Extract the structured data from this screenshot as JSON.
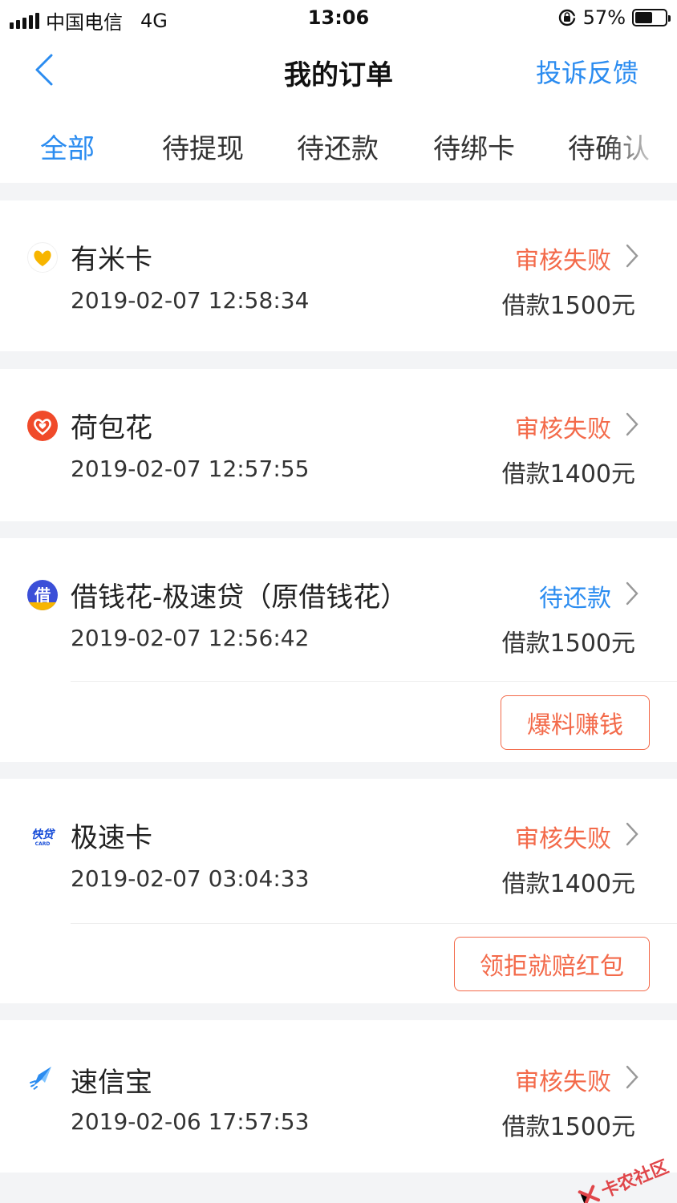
{
  "status_bar": {
    "carrier": "中国电信",
    "network": "4G",
    "time": "13:06",
    "battery_percent": "57%",
    "battery_level": 0.57
  },
  "nav": {
    "title": "我的订单",
    "action_label": "投诉反馈"
  },
  "tabs": [
    {
      "label": "全部",
      "active": true
    },
    {
      "label": "待提现",
      "active": false
    },
    {
      "label": "待还款",
      "active": false
    },
    {
      "label": "待绑卡",
      "active": false
    },
    {
      "label": "待确认",
      "active": false
    }
  ],
  "orders": [
    {
      "name": "有米卡",
      "date": "2019-02-07 12:58:34",
      "status": "审核失败",
      "status_color": "#f36a4a",
      "amount": "借款1500元",
      "icon": "youmika-logo-icon"
    },
    {
      "name": "荷包花",
      "date": "2019-02-07 12:57:55",
      "status": "审核失败",
      "status_color": "#f36a4a",
      "amount": "借款1400元",
      "icon": "hebaohua-logo-icon"
    },
    {
      "name": "借钱花-极速贷（原借钱花）",
      "date": "2019-02-07 12:56:42",
      "status": "待还款",
      "status_color": "#2b8cf0",
      "amount": "借款1500元",
      "icon": "jieqianhua-logo-icon",
      "action": "爆料赚钱"
    },
    {
      "name": "极速卡",
      "date": "2019-02-07 03:04:33",
      "status": "审核失败",
      "status_color": "#f36a4a",
      "amount": "借款1400元",
      "icon": "jisuka-logo-icon",
      "action": "领拒就赔红包"
    },
    {
      "name": "速信宝",
      "date": "2019-02-06 17:57:53",
      "status": "审核失败",
      "status_color": "#f36a4a",
      "amount": "借款1500元",
      "icon": "suxinbao-logo-icon"
    }
  ],
  "watermark": "卡农社区",
  "colors": {
    "accent": "#2b8cf0",
    "fail": "#f36a4a",
    "background": "#f3f4f6"
  }
}
